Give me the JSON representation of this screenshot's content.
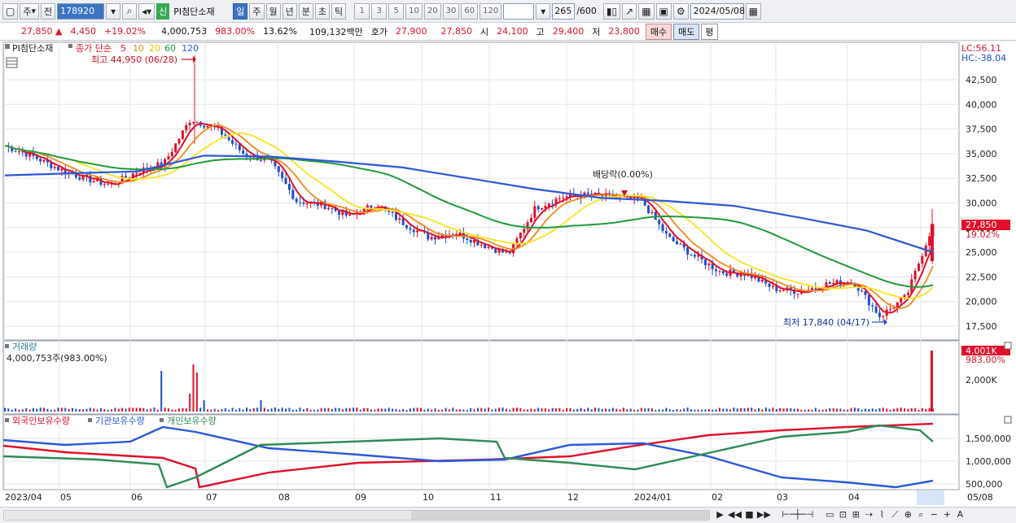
{
  "toolbar": {
    "market": "주",
    "prev": "전",
    "code": "178920",
    "stock_name": "PI첨단소재",
    "badge": "신",
    "periods": [
      "일",
      "주",
      "월",
      "년",
      "분",
      "초",
      "틱"
    ],
    "selected_period": "일",
    "nums": [
      "1",
      "3",
      "5",
      "10",
      "20",
      "30",
      "60",
      "120"
    ],
    "count": "265",
    "count_total": "/600",
    "date": "2024/05/08"
  },
  "quote": {
    "price": "27,850 ▲",
    "change": "4,450",
    "rate": "+19.02%",
    "volume": "4,000,753",
    "vol_rate": "983.00%",
    "turnover": "13.62%",
    "amount": "109,132백만",
    "bid_label": "호가",
    "bid1": "27,900",
    "bid2": "27,850",
    "open_label": "시",
    "open": "24,100",
    "high_label": "고",
    "high": "29,400",
    "low_label": "저",
    "low": "23,800",
    "buy": "매수",
    "sell": "매도",
    "eval": "평"
  },
  "price_panel": {
    "legend_stock": "PI첨단소재",
    "legend_label": "종가 단순",
    "ma_labels": [
      "5",
      "10",
      "20",
      "60",
      "120"
    ],
    "ma_colors": [
      "#e0102a",
      "#f08a1c",
      "#f5e51e",
      "#1f9a3a",
      "#2c58d8"
    ],
    "high_note": "최고 44,950 (06/28)",
    "low_note": "최저 17,840 (04/17)",
    "dividend_note": "배당락(0.00%)",
    "lc": "LC:56.11",
    "hc": "HC:-38.04",
    "current_price_tag": "27,850",
    "current_rate_tag": "19.02%",
    "y_labels": [
      "42,500",
      "40,000",
      "37,500",
      "35,000",
      "32,500",
      "30,000",
      "27,500",
      "25,000",
      "22,500",
      "20,000",
      "17,500"
    ]
  },
  "volume_panel": {
    "title": "거래량",
    "value": "4,000,753주(983.00%)",
    "tag_value": "4,001K",
    "tag_rate": "983.00%",
    "y_label": "2,000K"
  },
  "holding_panel": {
    "legend": [
      "외국인보유수량",
      "기관보유수량",
      "개인보유수량"
    ],
    "colors": [
      "#e0102a",
      "#2c58d8",
      "#2e8b57"
    ],
    "y_labels": [
      "1,500,000",
      "1,000,000",
      "500,000"
    ]
  },
  "x_axis": [
    "2023/04",
    "05",
    "06",
    "07",
    "08",
    "09",
    "10",
    "11",
    "12",
    "2024/01",
    "02",
    "03",
    "04",
    "05",
    "05/08"
  ],
  "chart_data": {
    "type": "candlestick",
    "dates_start": "2023/04",
    "dates_end": "2024/05/08",
    "close_approx": [
      35800,
      34800,
      33500,
      32500,
      31800,
      33200,
      34000,
      38500,
      37500,
      35000,
      34200,
      30200,
      29800,
      28600,
      29900,
      28000,
      26500,
      27000,
      25800,
      24800,
      29500,
      30600,
      30800,
      30600,
      30300,
      26500,
      24600,
      23000,
      22800,
      21300,
      21000,
      21800,
      22000,
      18500,
      20500,
      27850
    ],
    "ma120_approx": [
      32800,
      33000,
      33200,
      34800,
      34700,
      34200,
      33600,
      32500,
      31400,
      30500,
      30200,
      29700,
      28500,
      27200,
      25000
    ],
    "last": {
      "open": 24100,
      "high": 29400,
      "low": 23800,
      "close": 27850
    },
    "period_high": {
      "value": 44950,
      "date": "06/28"
    },
    "period_low": {
      "value": 17840,
      "date": "04/17"
    }
  }
}
